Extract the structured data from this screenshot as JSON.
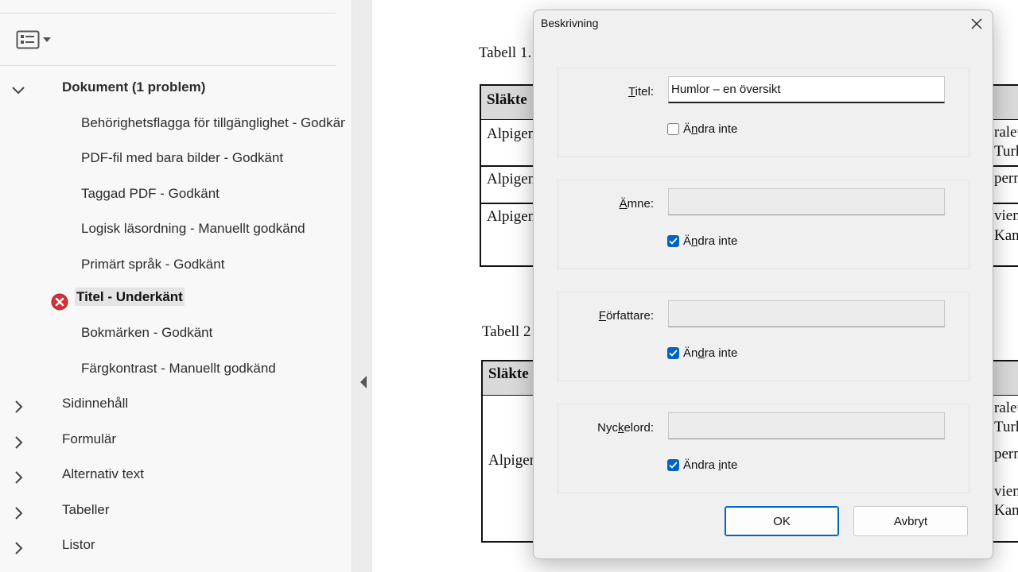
{
  "panel": {
    "group_expanded": {
      "title": "Dokument (1 problem)",
      "items": [
        {
          "label": "Behörighetsflagga för tillgänglighet - Godkänt"
        },
        {
          "label": "PDF-fil med bara bilder - Godkänt"
        },
        {
          "label": "Taggad PDF - Godkänt"
        },
        {
          "label": "Logisk läsordning - Manuellt godkänd"
        },
        {
          "label": "Primärt språk - Godkänt"
        },
        {
          "label": "Titel - Underkänt",
          "status": "failed"
        },
        {
          "label": "Bokmärken - Godkänt"
        },
        {
          "label": "Färgkontrast - Manuellt godkänd"
        }
      ]
    },
    "groups_collapsed": [
      {
        "label": "Sidinnehåll"
      },
      {
        "label": "Formulär"
      },
      {
        "label": "Alternativ text"
      },
      {
        "label": "Tabeller"
      },
      {
        "label": "Listor"
      }
    ]
  },
  "document": {
    "table1_caption": "Tabell 1.",
    "table2_caption": "Tabell 2",
    "header_cell": "Släkte",
    "row_cell": "Alpigen",
    "right_fragments": [
      "raleu",
      "Turk",
      "pern",
      "vien",
      "Kana"
    ]
  },
  "dialog": {
    "title": "Beskrivning",
    "fields": [
      {
        "label": "Titel:",
        "value": "Humlor – en översikt",
        "checkbox_label": "Ändra inte",
        "checked": false
      },
      {
        "label": "Ämne:",
        "value": "",
        "checkbox_label": "Ändra inte",
        "checked": true
      },
      {
        "label": "Författare:",
        "value": "",
        "checkbox_label": "Ändra inte",
        "checked": true
      },
      {
        "label": "Nyckelord:",
        "value": "",
        "checkbox_label": "Ändra inte",
        "checked": true
      }
    ],
    "ok_label": "OK",
    "cancel_label": "Avbryt"
  },
  "colors": {
    "checkbox_accent": "#0063c3",
    "fail_red": "#d1343a"
  }
}
